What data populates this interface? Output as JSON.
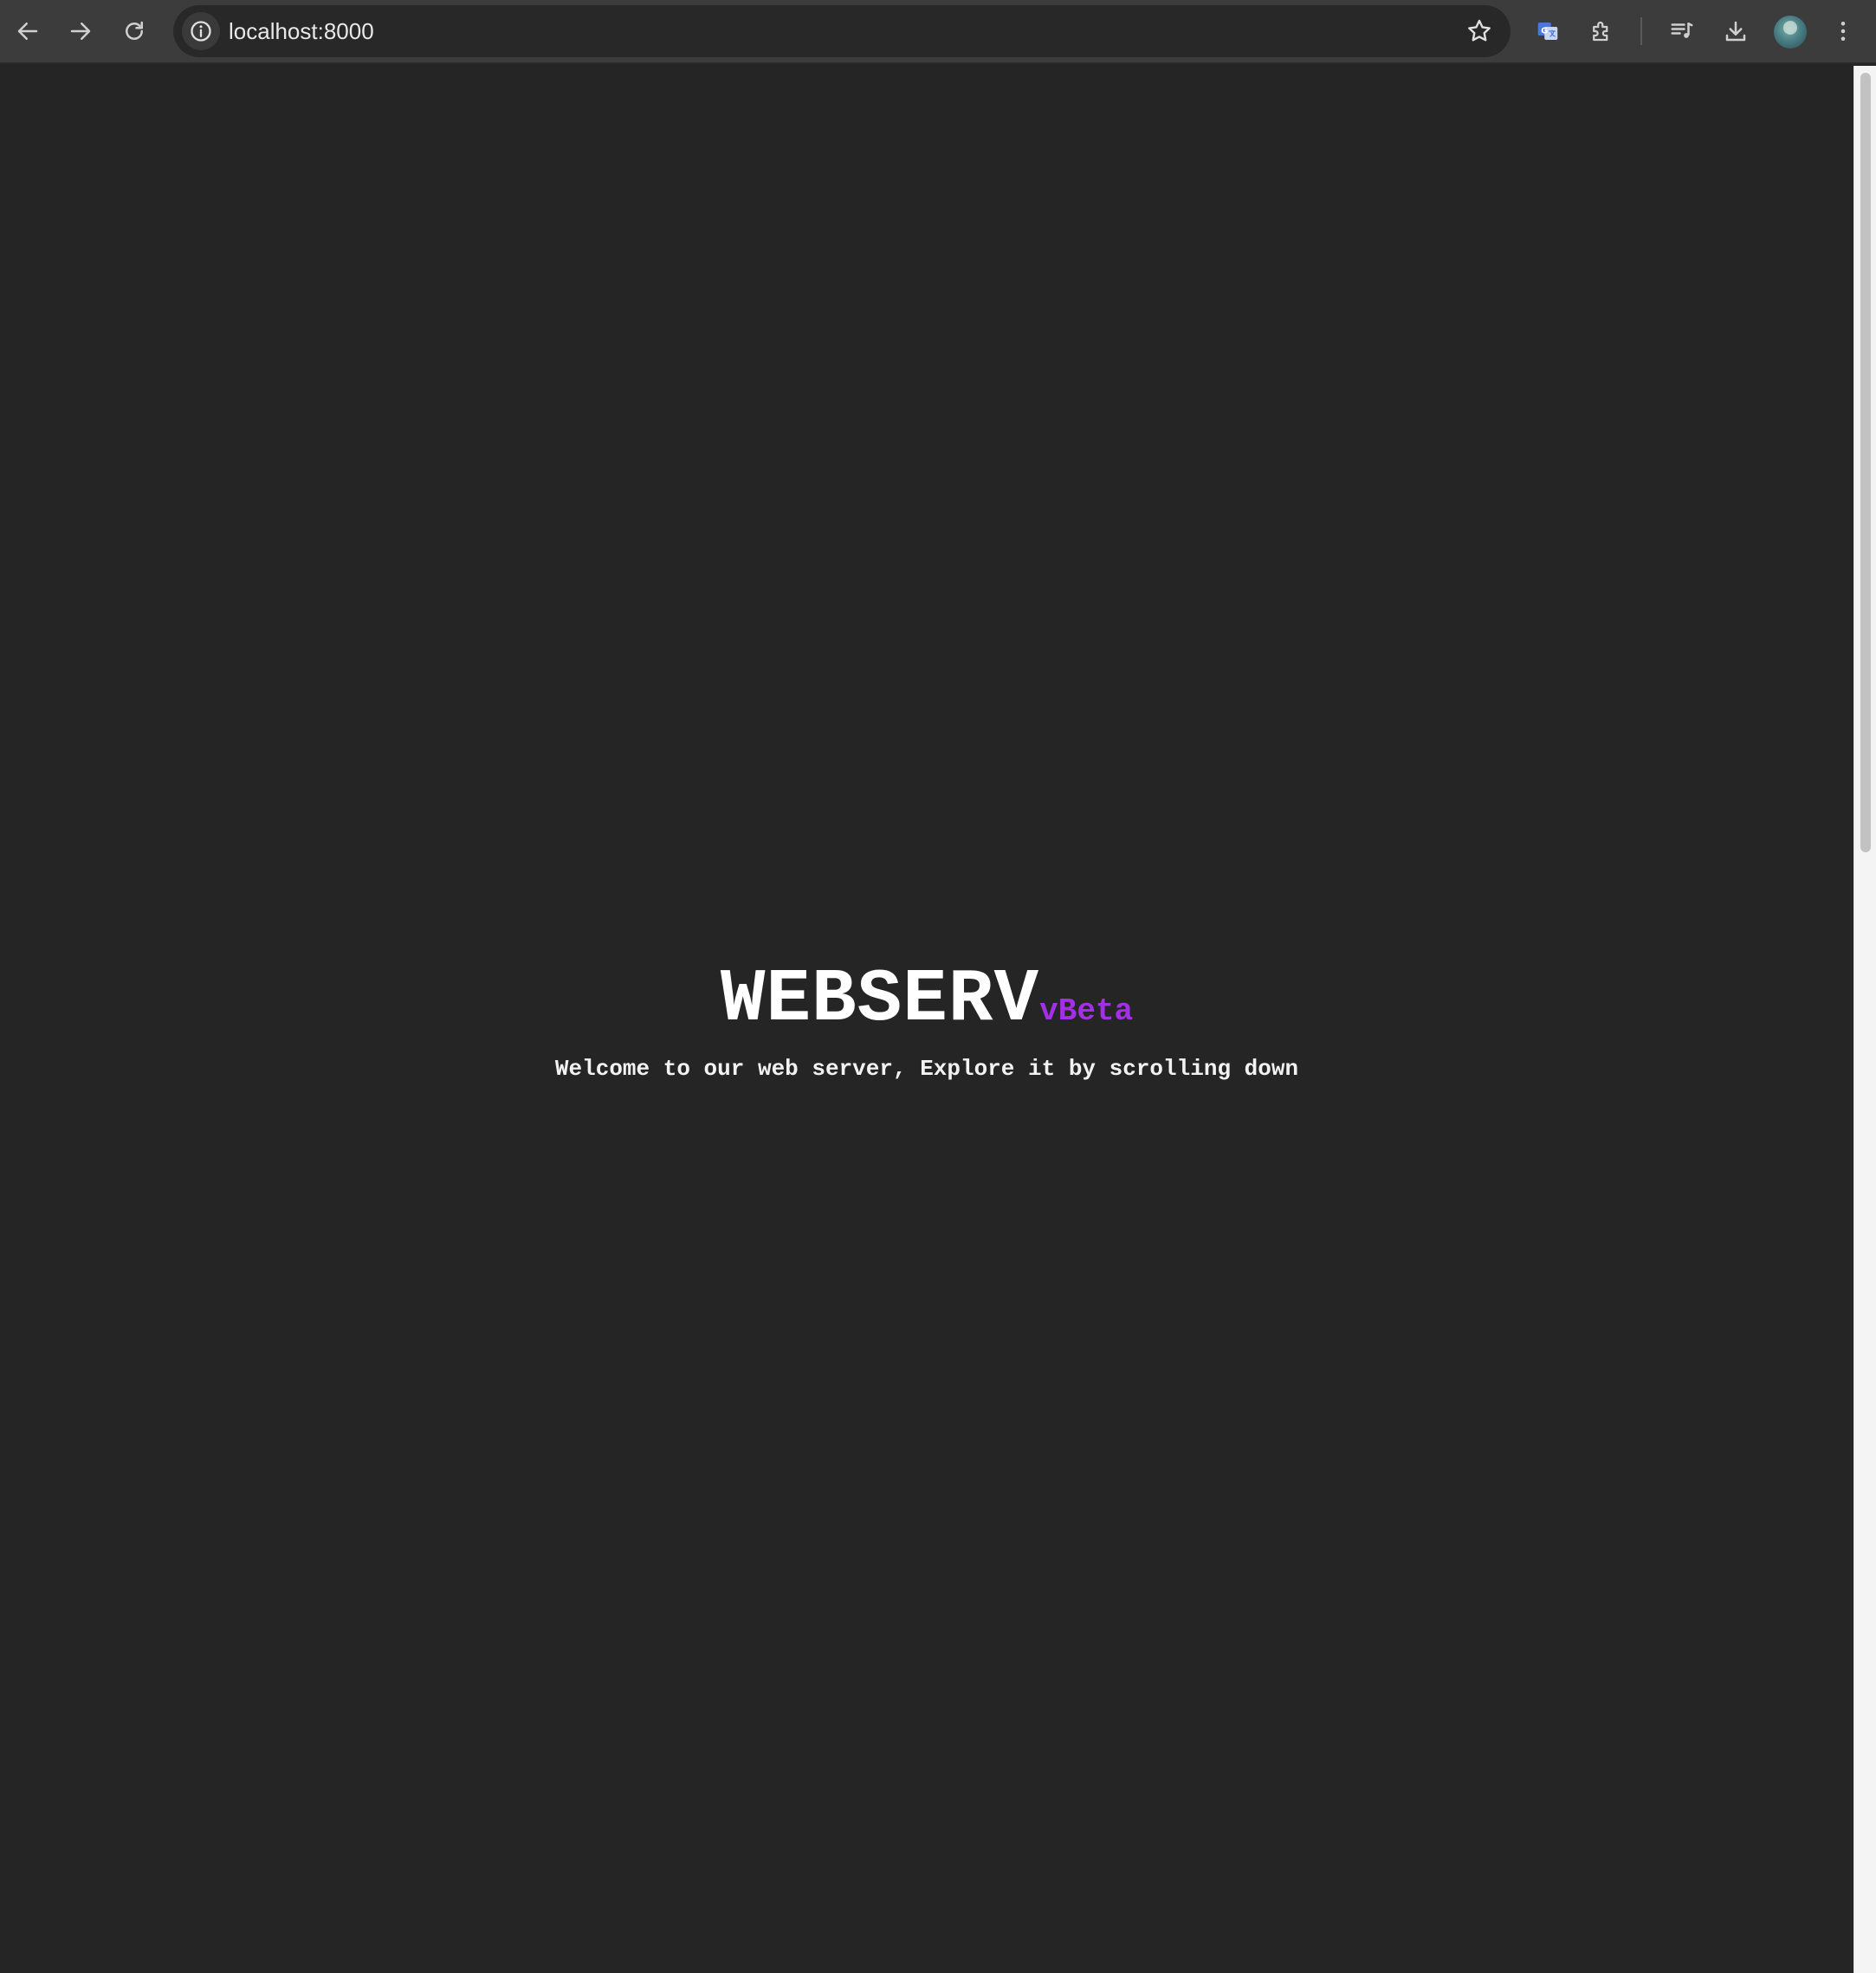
{
  "browser": {
    "url": "localhost:8000",
    "icons": {
      "back": "arrow-left-icon",
      "forward": "arrow-right-icon",
      "reload": "reload-icon",
      "site_info": "info-icon",
      "bookmark": "star-icon",
      "translate": "translate-icon",
      "extensions": "puzzle-icon",
      "media": "media-queue-icon",
      "downloads": "download-icon",
      "profile": "avatar",
      "menu": "kebab-menu-icon"
    }
  },
  "page": {
    "title": "WEBSERV",
    "version": "vBeta",
    "subtitle": "Welcome to our web server, Explore it by scrolling down"
  },
  "colors": {
    "background": "#252525",
    "toolbar": "#3c3c3c",
    "title": "#ffffff",
    "accent": "#a330e6"
  }
}
